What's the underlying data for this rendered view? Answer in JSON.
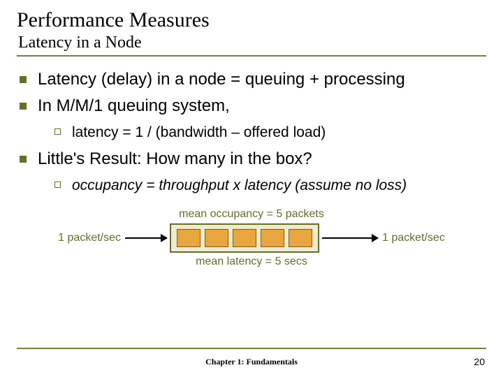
{
  "title": "Performance Measures",
  "subtitle": "Latency in a Node",
  "bullets": {
    "b1a": "Latency (delay) in a node = queuing + processing",
    "b1b": "In M/M/1 queuing system,",
    "b2a": "latency = 1 / (bandwidth – offered load)",
    "b1c": "Little's Result: How many in the box?",
    "b2b": "occupancy = throughput x latency (assume no loss)"
  },
  "diagram": {
    "top_caption": "mean occupancy = 5 packets",
    "left_label": "1 packet/sec",
    "right_label": "1 packet/sec",
    "bottom_caption": "mean latency = 5 secs",
    "packet_count": 5
  },
  "footer": {
    "center": "Chapter 1: Fundamentals",
    "page": "20"
  }
}
